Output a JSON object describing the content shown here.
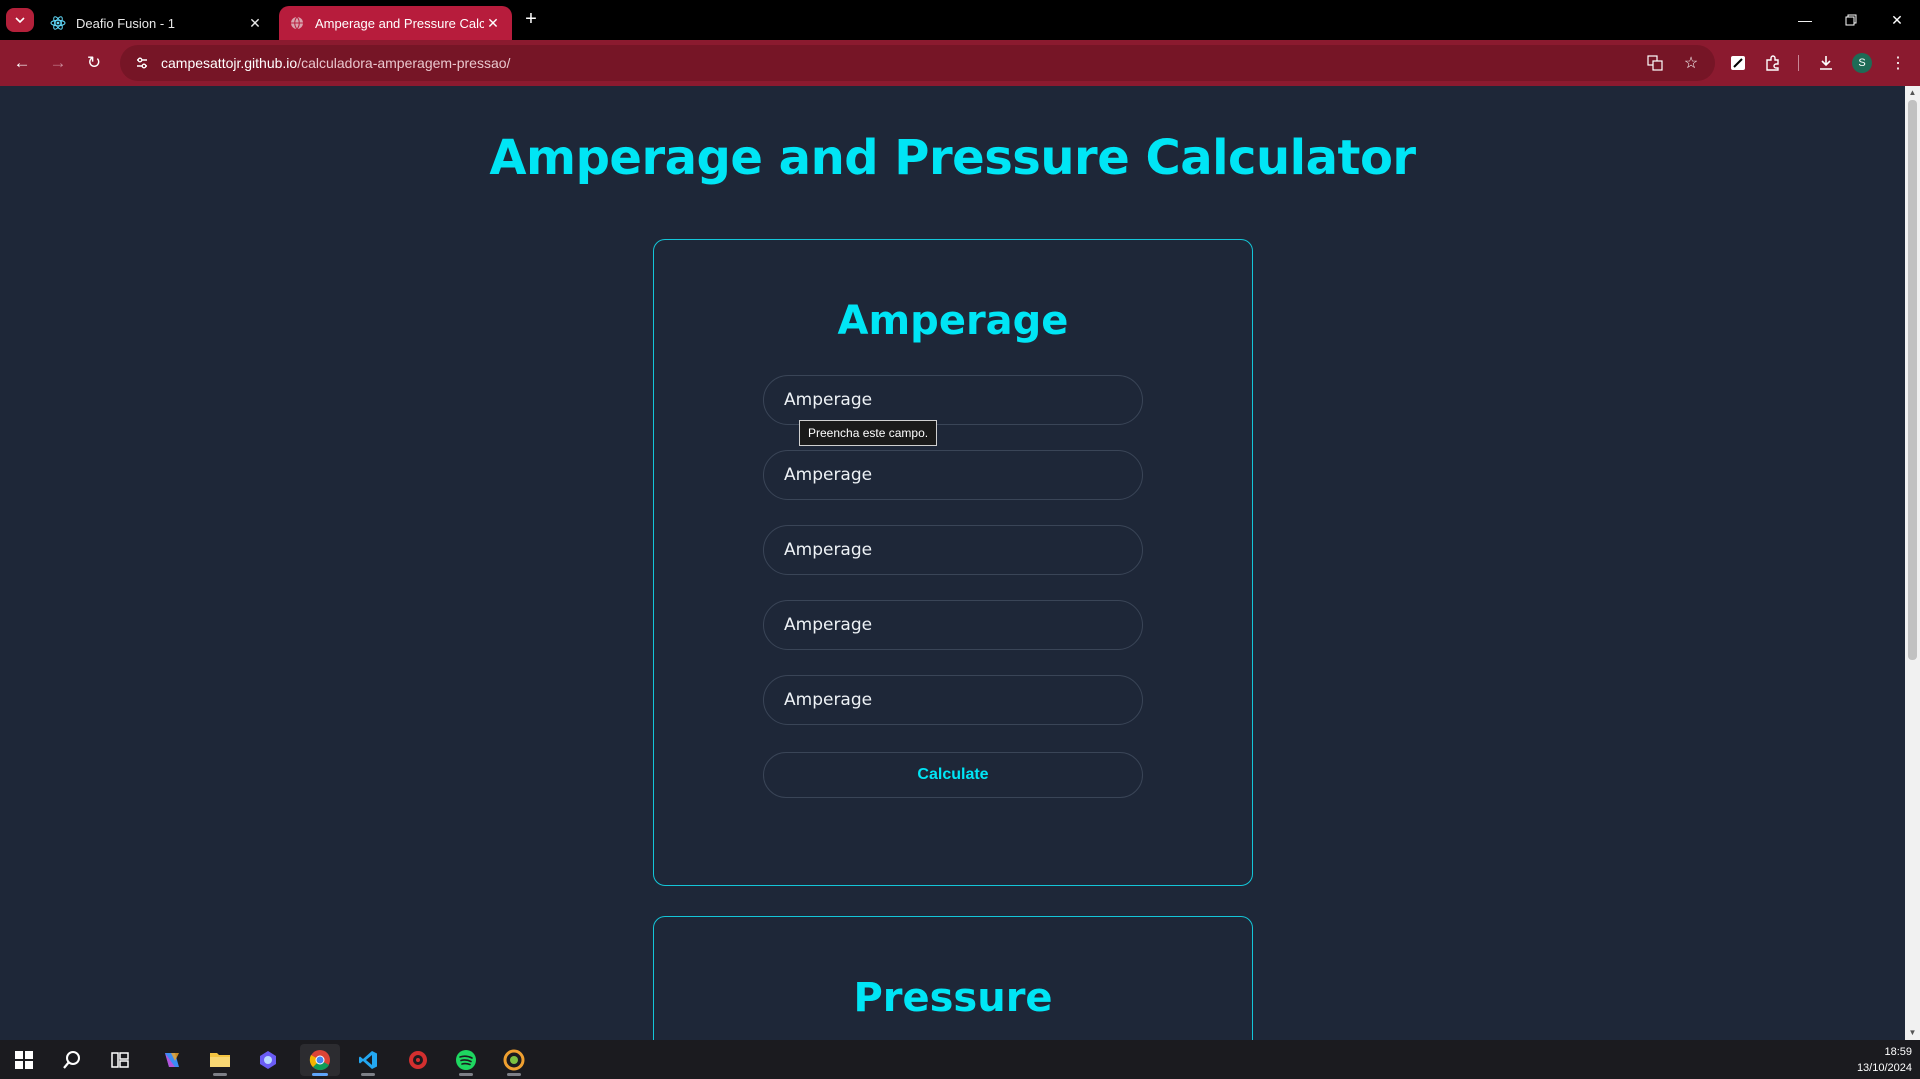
{
  "browser": {
    "tabs": [
      {
        "title": "Deafio Fusion - 1",
        "active": false
      },
      {
        "title": "Amperage and Pressure Calcula",
        "active": true
      }
    ],
    "url_host": "campesattojr.github.io",
    "url_path": "/calculadora-amperagem-pressao/",
    "profile_initial": "S",
    "accent_color": "#8b1a2f"
  },
  "page": {
    "title": "Amperage and Pressure Calculator",
    "amperage_card": {
      "title": "Amperage",
      "inputs": [
        {
          "placeholder": "Amperage"
        },
        {
          "placeholder": "Amperage"
        },
        {
          "placeholder": "Amperage"
        },
        {
          "placeholder": "Amperage"
        },
        {
          "placeholder": "Amperage"
        }
      ],
      "button_label": "Calculate",
      "validation_tooltip": "Preencha este campo."
    },
    "pressure_card": {
      "title": "Pressure"
    },
    "accent_color": "#00e5f5",
    "background_color": "#1e2738"
  },
  "taskbar": {
    "time": "18:59",
    "date": "13/10/2024"
  }
}
